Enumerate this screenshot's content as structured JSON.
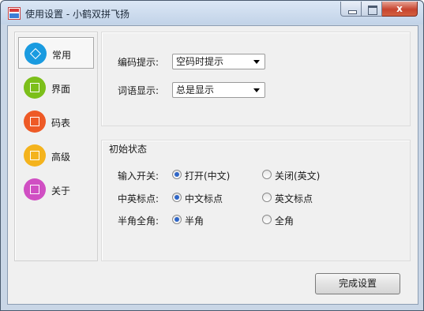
{
  "window": {
    "title": "使用设置 - 小鹤双拼飞扬",
    "close_label": "x"
  },
  "sidebar": {
    "items": [
      {
        "label": "常用",
        "icon": "common-icon",
        "color": "#1a9be0",
        "selected": true
      },
      {
        "label": "界面",
        "icon": "interface-icon",
        "color": "#7cbf1a",
        "selected": false
      },
      {
        "label": "码表",
        "icon": "code-table-icon",
        "color": "#ee5a26",
        "selected": false
      },
      {
        "label": "高级",
        "icon": "advanced-icon",
        "color": "#f4b31d",
        "selected": false
      },
      {
        "label": "关于",
        "icon": "about-icon",
        "color": "#d04fc3",
        "selected": false
      }
    ]
  },
  "settings": {
    "code_hint": {
      "label": "编码提示:",
      "value": "空码时提示"
    },
    "word_display": {
      "label": "词语显示:",
      "value": "总是显示"
    }
  },
  "initial_state": {
    "title": "初始状态",
    "rows": [
      {
        "label": "输入开关:",
        "options": [
          "打开(中文)",
          "关闭(英文)"
        ],
        "selected": 0
      },
      {
        "label": "中英标点:",
        "options": [
          "中文标点",
          "英文标点"
        ],
        "selected": 0
      },
      {
        "label": "半角全角:",
        "options": [
          "半角",
          "全角"
        ],
        "selected": 0
      }
    ]
  },
  "buttons": {
    "finish": "完成设置"
  }
}
